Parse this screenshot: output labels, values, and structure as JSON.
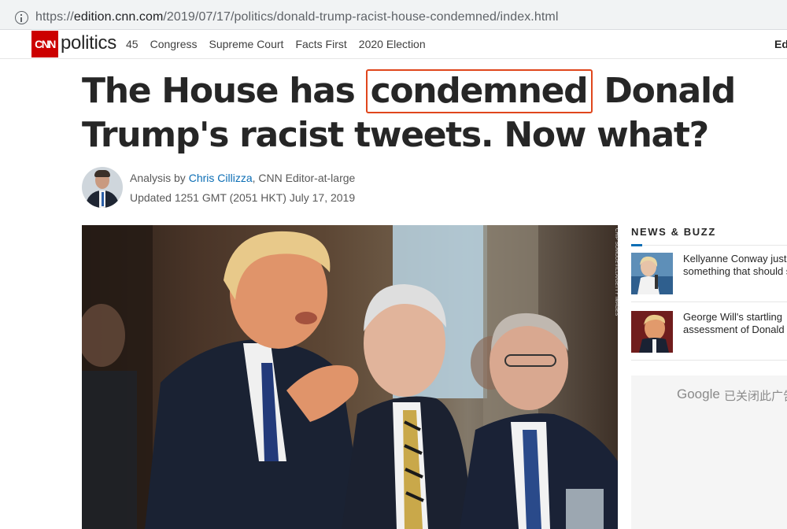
{
  "browser": {
    "url_prefix": "https://",
    "url_host": "edition.cnn.com",
    "url_path": "/2019/07/17/politics/donald-trump-racist-house-condemned/index.html"
  },
  "nav": {
    "logo_text": "CNN",
    "section": "politics",
    "items": [
      "45",
      "Congress",
      "Supreme Court",
      "Facts First",
      "2020 Election"
    ],
    "edition": "Ed"
  },
  "article": {
    "headline_before": "The House has ",
    "headline_highlight": "condemned",
    "headline_after": " Donald Trump's racist tweets. Now what?",
    "byline_prefix": "Analysis by ",
    "author": "Chris Cillizza",
    "author_title": ", CNN Editor-at-large",
    "updated": "Updated 1251 GMT (2051 HKT) July 17, 2019",
    "photo_credit": "CHIP SOMODEVILLA/GETTY IMAGES"
  },
  "sidebar": {
    "title": "NEWS & BUZZ",
    "items": [
      {
        "line1": "Kellyanne Conway just sa",
        "line2": "something that should st"
      },
      {
        "line1": "George Will's startling",
        "line2": "assessment of Donald Tr"
      }
    ]
  },
  "ad": {
    "google": "Google",
    "closed_text": "已关闭此广告"
  },
  "colors": {
    "cnn_red": "#cc0000",
    "link_blue": "#0c6eb5",
    "highlight_box": "#e0461c"
  }
}
